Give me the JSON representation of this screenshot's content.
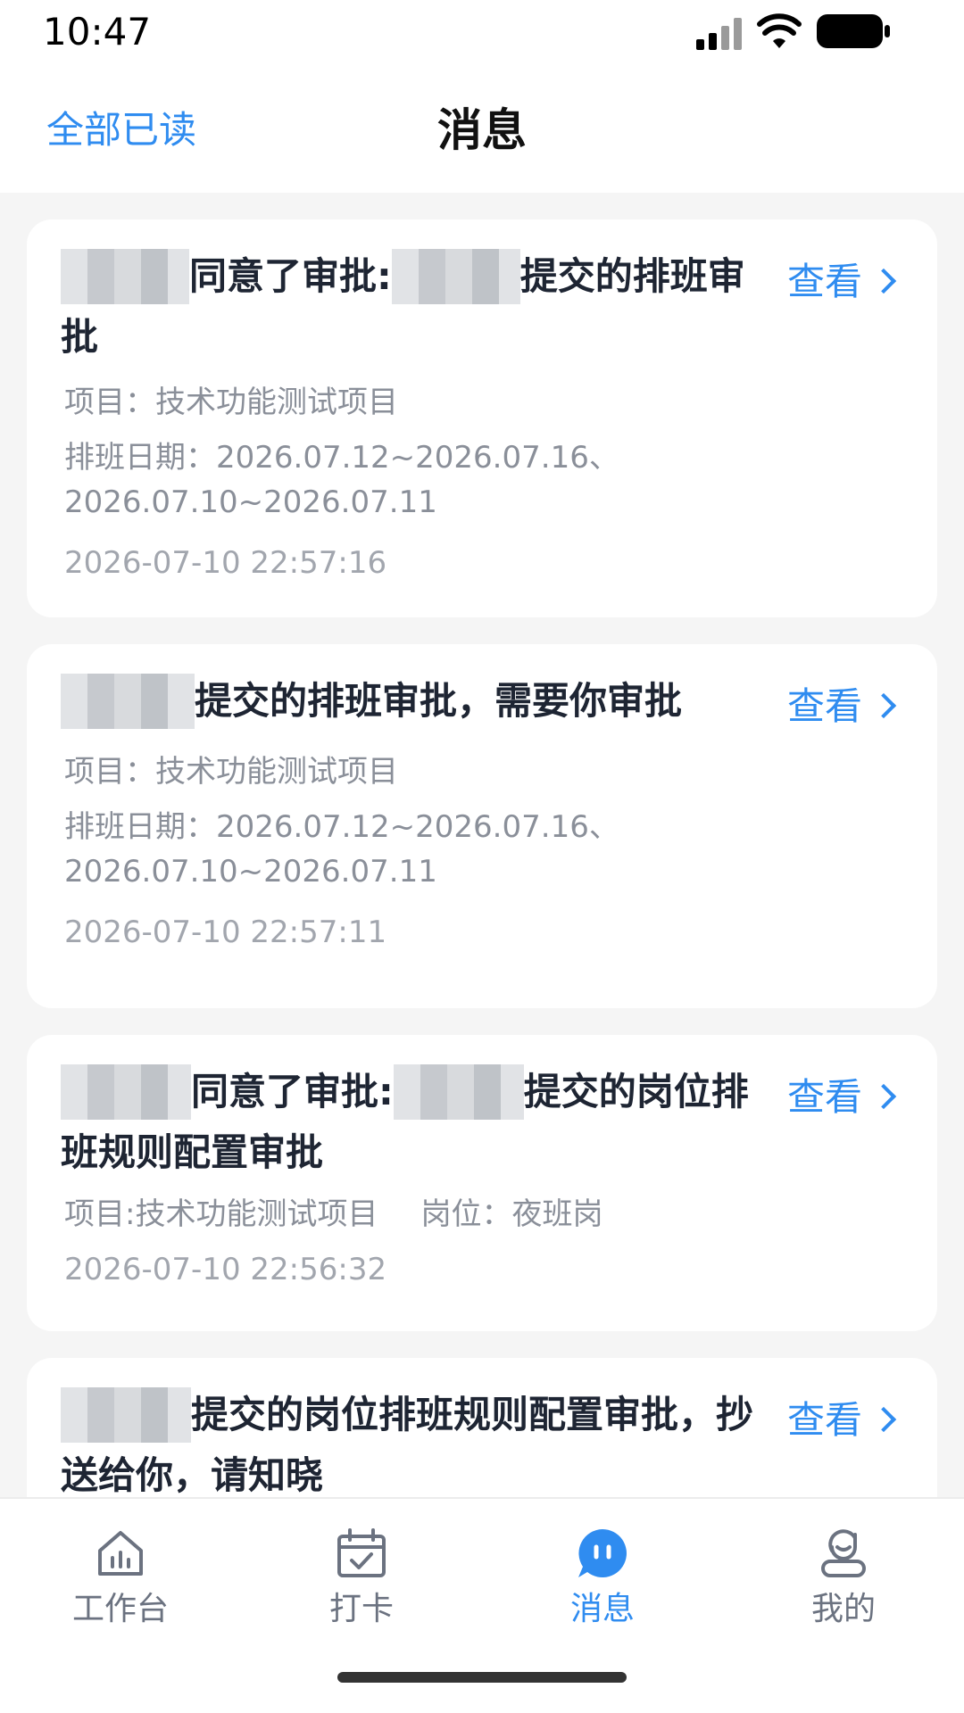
{
  "status_bar": {
    "time": "10:47"
  },
  "nav": {
    "mark_all_read": "全部已读",
    "title": "消息"
  },
  "messages": [
    {
      "title_part1": "同意了审批:",
      "title_part2": "提交的排班审批",
      "project": "项目：技术功能测试项目",
      "schedule": "排班日期：2026.07.12~2026.07.16、2026.07.10~2026.07.11",
      "time": "2026-07-10 22:57:16",
      "action": "查看"
    },
    {
      "title_part1": "提交的排班审批，需要你审批",
      "project": "项目：技术功能测试项目",
      "schedule": "排班日期：2026.07.12~2026.07.16、2026.07.10~2026.07.11",
      "time": "2026-07-10 22:57:11",
      "action": "查看"
    },
    {
      "title_part1": "同意了审批:",
      "title_part2": "提交的岗位排班规则配置审批",
      "project": "项目:技术功能测试项目",
      "post": "岗位：夜班岗",
      "time": "2026-07-10 22:56:32",
      "action": "查看"
    },
    {
      "title_part1": "提交的岗位排班规则配置审批，抄送给你，请知晓",
      "action": "查看"
    }
  ],
  "tabs": [
    {
      "label": "工作台",
      "icon": "workbench-icon",
      "active": false
    },
    {
      "label": "打卡",
      "icon": "calendar-check-icon",
      "active": false
    },
    {
      "label": "消息",
      "icon": "message-icon",
      "active": true
    },
    {
      "label": "我的",
      "icon": "profile-icon",
      "active": false
    }
  ],
  "colors": {
    "accent": "#2f8cf0",
    "title": "#1e2533",
    "meta": "#8a8f99",
    "background": "#f5f5f5"
  }
}
